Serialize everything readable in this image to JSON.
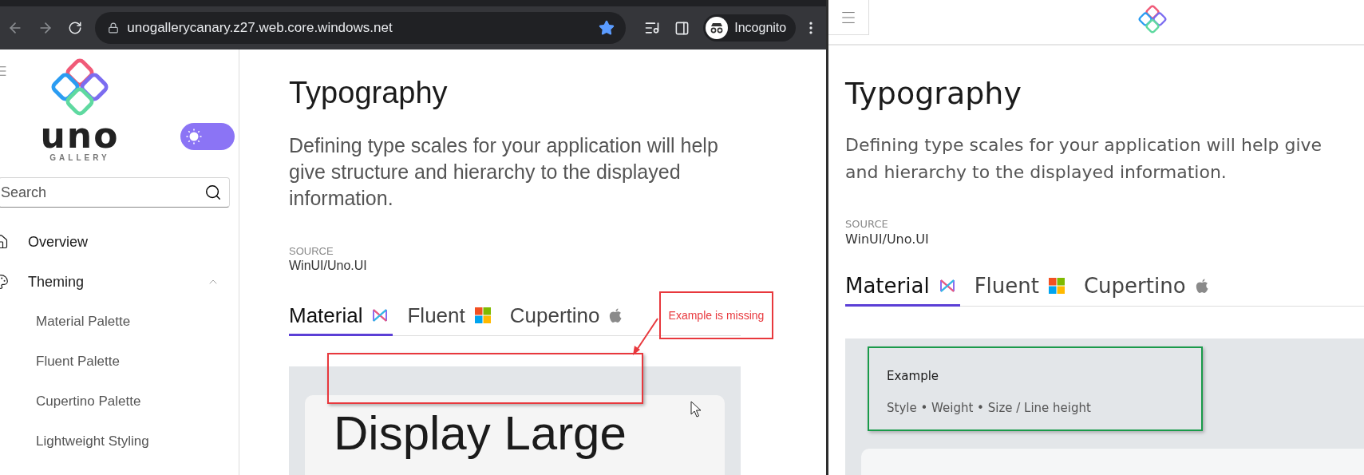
{
  "browser": {
    "url": "unogallerycanary.z27.web.core.windows.net",
    "bookmarked": true,
    "profile": "Incognito"
  },
  "left_app": {
    "sidebar": {
      "wordmark": "uno",
      "wordmark_sub": "GALLERY",
      "dark_mode": false,
      "search": {
        "placeholder": "Search"
      },
      "nav": [
        {
          "label": "Overview"
        },
        {
          "label": "Theming",
          "expanded": true,
          "children": [
            {
              "label": "Material Palette"
            },
            {
              "label": "Fluent Palette"
            },
            {
              "label": "Cupertino Palette"
            },
            {
              "label": "Lightweight Styling"
            }
          ]
        }
      ]
    },
    "page": {
      "title": "Typography",
      "description_lines": [
        "Defining type scales for your application will help",
        "give structure and hierarchy to the displayed",
        "information."
      ],
      "source_label": "SOURCE",
      "source": "WinUI/Uno.UI",
      "tabs": [
        {
          "label": "Material",
          "selected": true
        },
        {
          "label": "Fluent",
          "selected": false
        },
        {
          "label": "Cupertino",
          "selected": false
        }
      ],
      "example": {
        "heading": "Display Large"
      }
    },
    "annotation": {
      "note": "Example is missing"
    }
  },
  "right_app": {
    "page": {
      "title": "Typography",
      "description_lines": [
        "Defining type scales for your application will help give",
        "and hierarchy to the displayed information."
      ],
      "source_label": "SOURCE",
      "source": "WinUI/Uno.UI",
      "tabs": [
        {
          "label": "Material",
          "selected": true
        },
        {
          "label": "Fluent",
          "selected": false
        },
        {
          "label": "Cupertino",
          "selected": false
        }
      ],
      "example": {
        "title": "Example",
        "subtitle": "Style • Weight • Size / Line height"
      }
    }
  }
}
